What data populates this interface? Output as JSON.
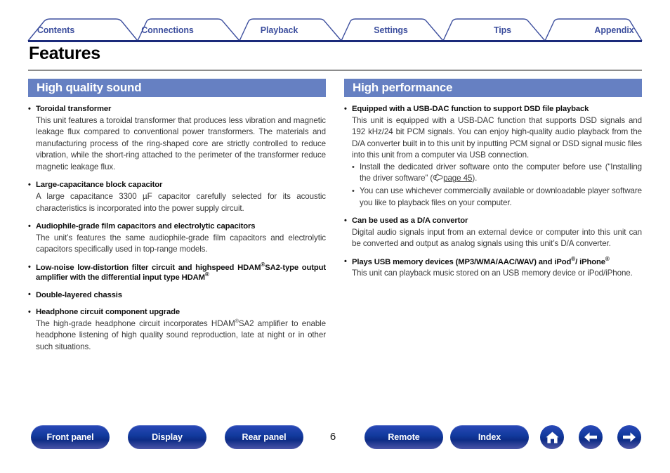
{
  "tabs": [
    {
      "label": "Contents",
      "name": "tab-contents"
    },
    {
      "label": "Connections",
      "name": "tab-connections"
    },
    {
      "label": "Playback",
      "name": "tab-playback"
    },
    {
      "label": "Settings",
      "name": "tab-settings"
    },
    {
      "label": "Tips",
      "name": "tab-tips"
    },
    {
      "label": "Appendix",
      "name": "tab-appendix"
    }
  ],
  "page": {
    "title": "Features",
    "number": "6"
  },
  "left_column": {
    "header": "High quality sound",
    "blocks": [
      {
        "heading": "Toroidal transformer",
        "body": "This unit features a toroidal transformer that produces less vibration and magnetic leakage flux compared to conventional power transformers. The materials and manufacturing process of the ring-shaped core are strictly controlled to reduce vibration, while the short-ring attached to the perimeter of the transformer reduce magnetic leakage flux."
      },
      {
        "heading": "Large-capacitance block capacitor",
        "body": "A large capacitance 3300 µF capacitor carefully selected for its acoustic characteristics is incorporated into the power supply circuit."
      },
      {
        "heading": "Audiophile-grade film capacitors and electrolytic capacitors",
        "body": "The unit’s features the same audiophile-grade film capacitors and electrolytic capacitors specifically used in top-range models."
      },
      {
        "heading": "Low-noise low-distortion filter circuit and highspeed HDAM® SA2-type output amplifier with the differential input type HDAM®",
        "body": ""
      },
      {
        "heading": "Double-layered chassis",
        "body": ""
      },
      {
        "heading": "Headphone circuit component upgrade",
        "body": "The high-grade headphone circuit incorporates HDAM®SA2 amplifier to enable headphone listening of high quality sound reproduction, late at night or in other such situations."
      }
    ]
  },
  "right_column": {
    "header": "High performance",
    "blocks": [
      {
        "heading": "Equipped with a USB-DAC function to support DSD file playback",
        "body": "This unit is equipped with a USB-DAC function that supports DSD signals and 192 kHz/24 bit PCM signals. You can enjoy high-quality audio playback from the D/A converter built in to this unit by inputting PCM signal or DSD signal music files into this unit from a computer via USB connection.",
        "sub_items": [
          {
            "text_before": "Install the dedicated driver software onto the computer before use (“Installing the driver software” (",
            "link": "page 45",
            "text_after": ")."
          },
          {
            "text_before": "You can use whichever commercially available or downloadable player software you like to playback files on your computer.",
            "link": "",
            "text_after": ""
          }
        ]
      },
      {
        "heading": "Can be used as a D/A convertor",
        "body": "Digital audio signals input from an external device or computer into this unit can be converted and output as analog signals using this unit’s D/A converter."
      },
      {
        "heading": "Plays USB memory devices (MP3/WMA/AAC/WAV) and iPod®/iPhone®",
        "body": "This unit can playback music stored on an USB memory device or iPod/iPhone."
      }
    ]
  },
  "footer": {
    "buttons": [
      {
        "label": "Front panel",
        "name": "front-panel-button"
      },
      {
        "label": "Display",
        "name": "display-button"
      },
      {
        "label": "Rear panel",
        "name": "rear-panel-button"
      },
      {
        "label": "Remote",
        "name": "remote-button"
      },
      {
        "label": "Index",
        "name": "index-button"
      }
    ],
    "icons": [
      {
        "name": "home-icon",
        "glyph": "home"
      },
      {
        "name": "arrow-left-icon",
        "glyph": "arrow-left"
      },
      {
        "name": "arrow-right-icon",
        "glyph": "arrow-right"
      }
    ]
  },
  "colors": {
    "tab_text": "#3d4f9e",
    "tab_rule": "#1b2a7a",
    "section_header_bg": "#6680c2",
    "button_blue": "#123a9e",
    "body_text": "#3a3a3a"
  }
}
